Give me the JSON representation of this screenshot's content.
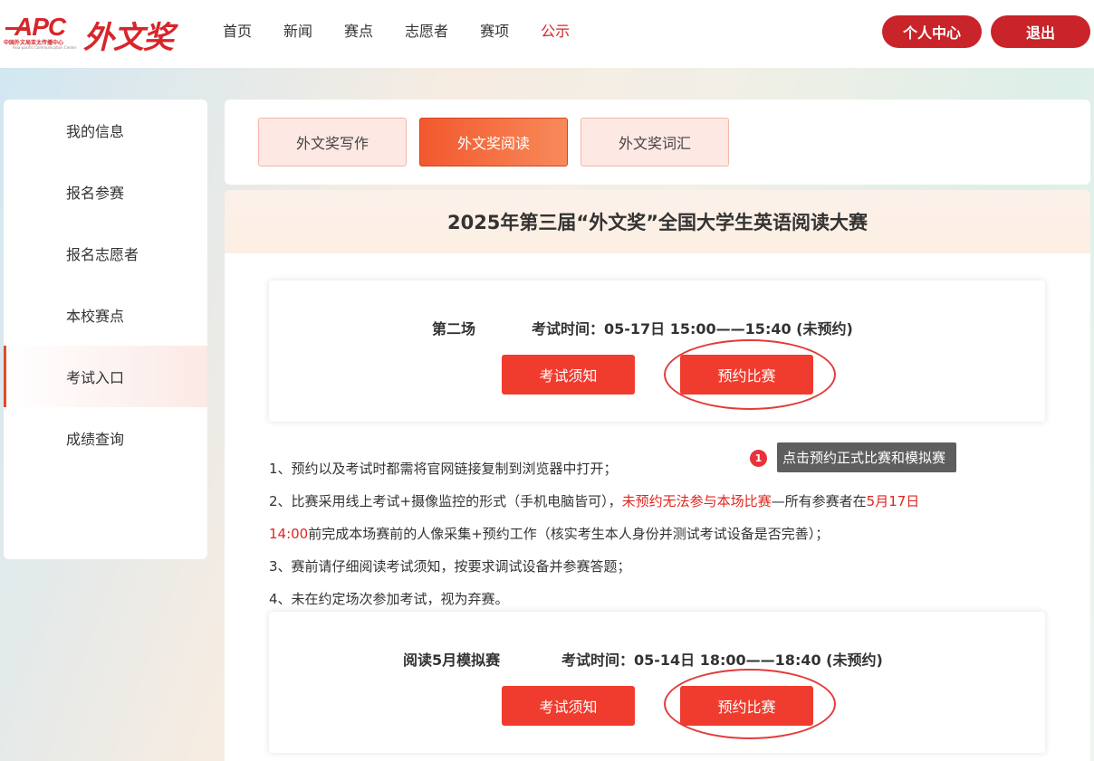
{
  "header": {
    "logo_apc": "APC",
    "logo_apc_sub": "中国外文局亚太传播中心",
    "logo_apc_sub2": "Asia-pacific Communication Center",
    "logo_brand": "外文奖",
    "nav": [
      "首页",
      "新闻",
      "赛点",
      "志愿者",
      "赛项",
      "公示"
    ],
    "nav_active_index": 5,
    "user_center": "个人中心",
    "logout": "退出"
  },
  "sidebar": {
    "items": [
      "我的信息",
      "报名参赛",
      "报名志愿者",
      "本校赛点",
      "考试入口",
      "成绩查询"
    ],
    "active_index": 4
  },
  "tabs": {
    "items": [
      "外文奖写作",
      "外文奖阅读",
      "外文奖词汇"
    ],
    "active_index": 1
  },
  "main": {
    "title": "2025年第三届“外文奖”全国大学生英语阅读大赛",
    "exams": [
      {
        "name": "第二场",
        "time": "考试时间：05-17日 15:00——15:40 (未预约)",
        "notice_button": "考试须知",
        "book_button": "预约比赛"
      },
      {
        "name": "阅读5月模拟赛",
        "time": "考试时间：05-14日 18:00——18:40 (未预约)",
        "notice_button": "考试须知",
        "book_button": "预约比赛"
      }
    ],
    "notes": {
      "n1": "1、预约以及考试时都需将官网链接复制到浏览器中打开；",
      "n2_a": "2、比赛采用线上考试+摄像监控的形式（手机电脑皆可），",
      "n2_red1": "未预约无法参与本场比赛",
      "n2_b": "—所有参赛者在",
      "n2_red2": "5月17日",
      "n2_red3": "14:00",
      "n2_c": "前完成本场赛前的人像采集+预约工作（核实考生本人身份并测试考试设备是否完善）；",
      "n3": "3、赛前请仔细阅读考试须知，按要求调试设备并参赛答题；",
      "n4": "4、未在约定场次参加考试，视为弃赛。"
    }
  },
  "annotation": {
    "badge": "1",
    "tooltip": "点击预约正式比赛和模拟赛"
  },
  "colors": {
    "brand_red": "#d7262b",
    "button_red": "#f03c2e",
    "tab_active": "#f2582d"
  }
}
